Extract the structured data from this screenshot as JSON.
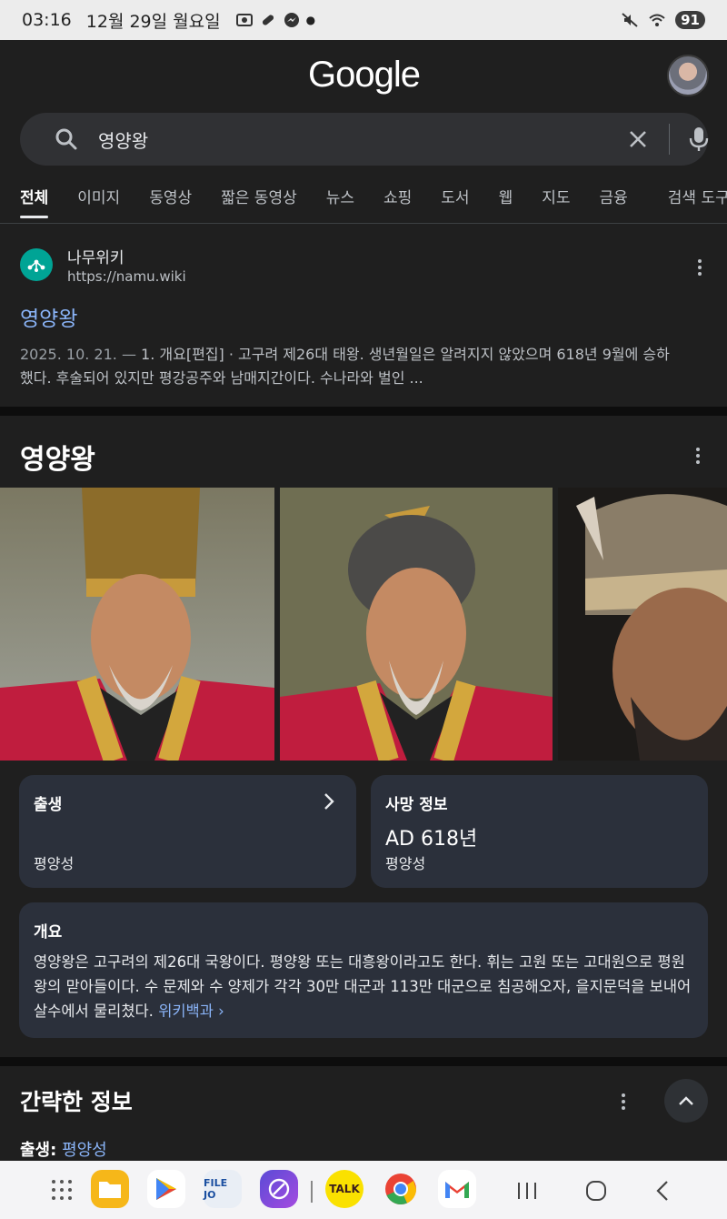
{
  "status_bar": {
    "time": "03:16",
    "date": "12월 29일 월요일",
    "battery": "91"
  },
  "header": {
    "logo": "Google"
  },
  "search": {
    "query": "영양왕"
  },
  "tabs": [
    "전체",
    "이미지",
    "동영상",
    "짧은 동영상",
    "뉴스",
    "쇼핑",
    "도서",
    "웹",
    "지도",
    "금융",
    "검색 도구"
  ],
  "result": {
    "site_name": "나무위키",
    "url": "https://namu.wiki",
    "title": "영양왕",
    "date": "2025. 10. 21. —",
    "snippet_line1": " 1. 개요[편집] · 고구려 제26대 태왕. 생년월일은 알려지지 않았으며 618년 9월에 승하",
    "snippet_line2": "했다. 후술되어 있지만 평강공주와 남매지간이다. 수나라와 벌인 ..."
  },
  "knowledge_panel": {
    "title": "영양왕",
    "birth_card": {
      "label": "출생",
      "value": "평양성"
    },
    "death_card": {
      "label": "사망 정보",
      "value_main": "AD 618년",
      "value_sub": "평양성"
    },
    "overview": {
      "label": "개요",
      "text": "영양왕은 고구려의 제26대 국왕이다. 평양왕 또는 대흥왕이라고도 한다. 휘는 고원 또는 고대원으로 평원왕의 맏아들이다. 수 문제와 수 양제가 각각 30만 대군과 113만 대군으로 침공해오자, 을지문덕을 보내어 살수에서 물리쳤다.",
      "link": "위키백과 ›"
    }
  },
  "brief_info": {
    "title": "간략한 정보",
    "birth_key": "출생:",
    "birth_value": "평양성"
  },
  "dock": {
    "apps": [
      "file-manager",
      "play-store",
      "file-jo",
      "browser",
      "kakaotalk",
      "chrome",
      "gmail"
    ],
    "talk_label": "TALK",
    "filejo_label": "FILE JO"
  },
  "colors": {
    "background": "#1f1f1f",
    "link": "#8ab4f8",
    "card": "#2b303b"
  }
}
